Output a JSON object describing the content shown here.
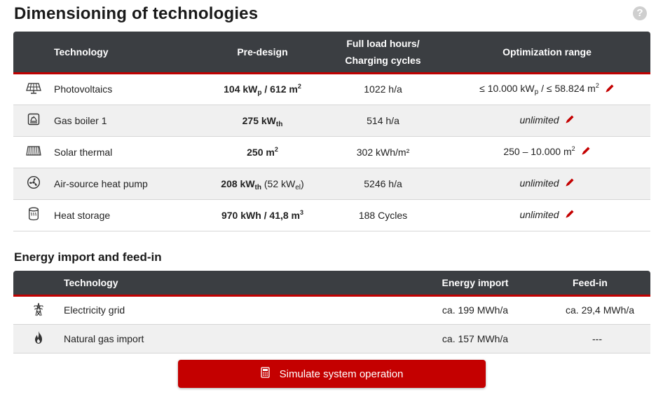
{
  "title": "Dimensioning of technologies",
  "help_icon_glyph": "?",
  "tech_table": {
    "headers": {
      "technology": "Technology",
      "pre_design": "Pre-design",
      "full_load_line1": "Full load hours/",
      "full_load_line2": "Charging cycles",
      "optimization": "Optimization range"
    },
    "rows": {
      "pv": {
        "icon": "solar-panel-icon",
        "name": "Photovoltaics",
        "pre_main": "104 kW",
        "pre_sub": "p",
        "pre_rest": " / 612 m",
        "pre_sup": "2",
        "full_load": "1022 h/a",
        "opt_a": "≤ 10.000 kW",
        "opt_sub": "p",
        "opt_b": " / ≤ 58.824 m",
        "opt_sup": "2"
      },
      "gas_boiler": {
        "icon": "gas-boiler-icon",
        "name": "Gas boiler 1",
        "pre_main": "275 kW",
        "pre_sub": "th",
        "full_load": "514 h/a",
        "opt": "unlimited"
      },
      "solar_thermal": {
        "icon": "solar-thermal-collector-icon",
        "name": "Solar thermal",
        "pre_main": "250 m",
        "pre_sup": "2",
        "full_load": "302 kWh/m²",
        "opt_a": "250 – 10.000 m",
        "opt_sup": "2"
      },
      "heat_pump": {
        "icon": "heat-pump-fan-icon",
        "name": "Air-source heat pump",
        "pre_main": "208 kW",
        "pre_sub": "th",
        "pre_rest": " (52 kW",
        "pre_sub2": "el",
        "pre_end": ")",
        "full_load": "5246 h/a",
        "opt": "unlimited"
      },
      "heat_storage": {
        "icon": "heat-storage-tank-icon",
        "name": "Heat storage",
        "pre_main": "970 kWh / 41,8 m",
        "pre_sup": "3",
        "full_load": "188 Cycles",
        "opt": "unlimited"
      }
    }
  },
  "energy_section": {
    "title": "Energy import and feed-in",
    "headers": {
      "technology": "Technology",
      "import": "Energy import",
      "feed_in": "Feed-in"
    },
    "rows": {
      "grid": {
        "icon": "power-pylon-icon",
        "name": "Electricity grid",
        "import": "ca. 199 MWh/a",
        "feed_in": "ca. 29,4 MWh/a"
      },
      "gas": {
        "icon": "flame-icon",
        "name": "Natural gas import",
        "import": "ca. 157 MWh/a",
        "feed_in": "---"
      }
    }
  },
  "simulate_button": {
    "label": "Simulate system operation",
    "icon": "calculator-icon"
  },
  "colors": {
    "accent": "#c40000",
    "header_bg": "#3b3e42",
    "row_alt": "#f0f0f0"
  }
}
